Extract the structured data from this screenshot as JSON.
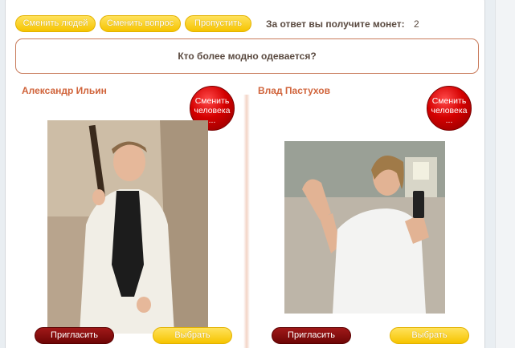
{
  "toolbar": {
    "change_people": "Сменить людей",
    "change_question": "Сменить вопрос",
    "skip": "Пропустить",
    "reward_label": "За ответ вы получите монет:",
    "reward_value": "2"
  },
  "question": "Кто более модно одевается?",
  "left": {
    "name": "Александр Ильин",
    "change_person": "Сменить человека ...",
    "invite": "Пригласить",
    "choose": "Выбрать"
  },
  "right": {
    "name": "Влад Пастухов",
    "change_person": "Сменить человека ...",
    "invite": "Пригласить",
    "choose": "Выбрать"
  },
  "colors": {
    "accent_yellow": "#f6c400",
    "accent_red": "#d40000",
    "name_color": "#d0633a",
    "invite_dark_red": "#7a0808"
  }
}
